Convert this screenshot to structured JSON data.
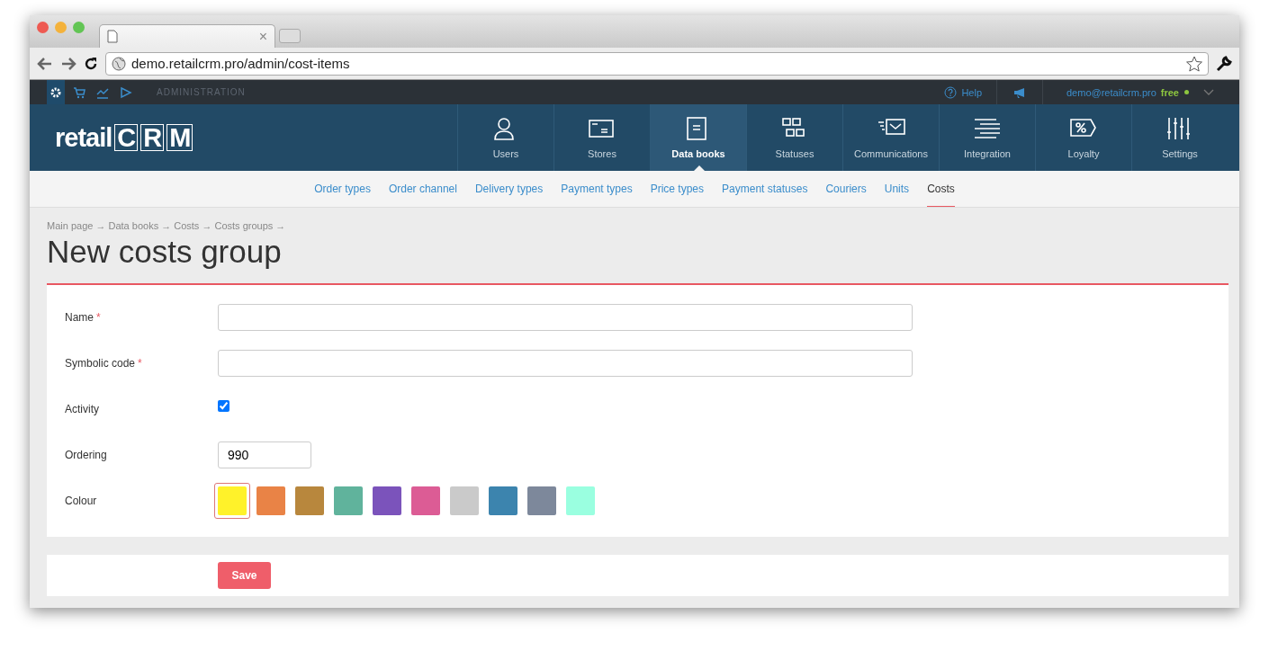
{
  "browser": {
    "tab_close": "×",
    "url": "demo.retailcrm.pro/admin/cost-items"
  },
  "admin_bar": {
    "icons": [
      {
        "selected": true
      },
      {
        "selected": false
      },
      {
        "selected": false
      },
      {
        "selected": false
      }
    ],
    "section": "ADMINISTRATION",
    "help": "Help",
    "user": "demo@retailcrm.pro",
    "plan": "free"
  },
  "logo": {
    "text": "retail",
    "letters": [
      "C",
      "R",
      "M"
    ]
  },
  "main_nav": [
    {
      "label": "Users",
      "selected": false
    },
    {
      "label": "Stores",
      "selected": false
    },
    {
      "label": "Data books",
      "selected": true
    },
    {
      "label": "Statuses",
      "selected": false
    },
    {
      "label": "Communications",
      "selected": false
    },
    {
      "label": "Integration",
      "selected": false
    },
    {
      "label": "Loyalty",
      "selected": false
    },
    {
      "label": "Settings",
      "selected": false
    }
  ],
  "sub_nav": [
    {
      "label": "Order types",
      "selected": false
    },
    {
      "label": "Order channel",
      "selected": false
    },
    {
      "label": "Delivery types",
      "selected": false
    },
    {
      "label": "Payment types",
      "selected": false
    },
    {
      "label": "Price types",
      "selected": false
    },
    {
      "label": "Payment statuses",
      "selected": false
    },
    {
      "label": "Couriers",
      "selected": false
    },
    {
      "label": "Units",
      "selected": false
    },
    {
      "label": "Costs",
      "selected": true
    }
  ],
  "breadcrumbs": "Main page → Data books → Costs → Costs groups →",
  "title": "New costs group",
  "form": {
    "fields": [
      {
        "kind": "text",
        "label": "Name",
        "required_mark": "*"
      },
      {
        "kind": "text",
        "label": "Symbolic code",
        "required_mark": "*"
      },
      {
        "kind": "checkbox",
        "label": "Activity",
        "checked": true
      },
      {
        "kind": "number",
        "label": "Ordering",
        "value": "990"
      },
      {
        "kind": "colors",
        "label": "Colour",
        "options": [
          {
            "color": "#fff22a",
            "selected": true
          },
          {
            "color": "#e98346",
            "selected": false
          },
          {
            "color": "#b8873d",
            "selected": false
          },
          {
            "color": "#60b39c",
            "selected": false
          },
          {
            "color": "#7b53bb",
            "selected": false
          },
          {
            "color": "#dc5c95",
            "selected": false
          },
          {
            "color": "#cacaca",
            "selected": false
          },
          {
            "color": "#3c84ae",
            "selected": false
          },
          {
            "color": "#7d889b",
            "selected": false
          },
          {
            "color": "#9affe0",
            "selected": false
          }
        ]
      }
    ]
  },
  "save_button": "Save"
}
